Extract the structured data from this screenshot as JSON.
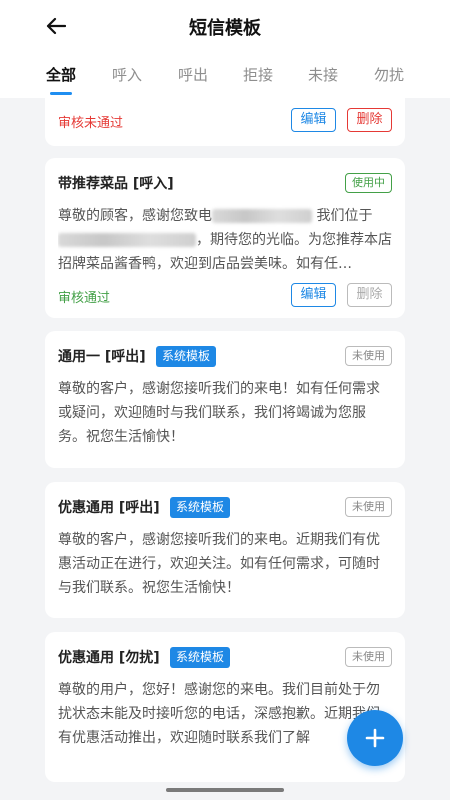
{
  "header": {
    "title": "短信模板"
  },
  "tabs": [
    {
      "label": "全部"
    },
    {
      "label": "呼入"
    },
    {
      "label": "呼出"
    },
    {
      "label": "拒接"
    },
    {
      "label": "未接"
    },
    {
      "label": "勿扰"
    }
  ],
  "cards": {
    "card0": {
      "review": "审核未通过",
      "edit": "编辑",
      "del": "删除"
    },
    "card1": {
      "title": "带推荐菜品 [呼入]",
      "status": "使用中",
      "body_a": "尊敬的顾客，感谢您致电",
      "body_b": "我们位于",
      "body_c": "，期待您的光临。为您推荐本店招牌菜品酱香鸭，欢迎到店品尝美味。如有任…",
      "review": "审核通过",
      "edit": "编辑",
      "del": "删除"
    },
    "card2": {
      "title": "通用一 [呼出]",
      "tag": "系统模板",
      "status": "未使用",
      "body": "尊敬的客户，感谢您接听我们的来电！如有任何需求或疑问，欢迎随时与我们联系，我们将竭诚为您服务。祝您生活愉快！"
    },
    "card3": {
      "title": "优惠通用 [呼出]",
      "tag": "系统模板",
      "status": "未使用",
      "body": "尊敬的客户，感谢您接听我们的来电。近期我们有优惠活动正在进行，欢迎关注。如有任何需求，可随时与我们联系。祝您生活愉快！"
    },
    "card4": {
      "title": "优惠通用 [勿扰]",
      "tag": "系统模板",
      "status": "未使用",
      "body": "尊敬的用户，您好！感谢您的来电。我们目前处于勿扰状态未能及时接听您的电话，深感抱歉。近期我们有优惠活动推出，欢迎随时联系我们了解"
    }
  }
}
